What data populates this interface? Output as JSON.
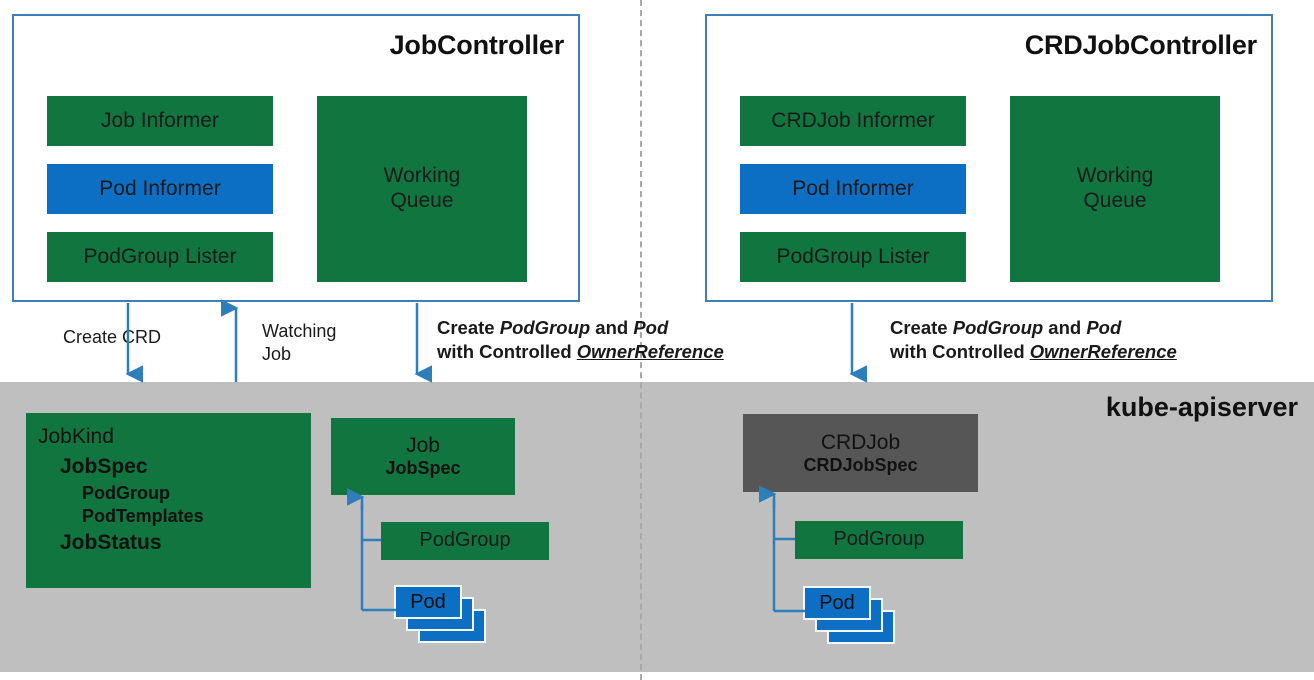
{
  "diagram": {
    "apiserver_label": "kube-apiserver",
    "colors": {
      "green": "#10753f",
      "blue": "#0d6fc4",
      "gray_band": "#bfbfbf",
      "dark_gray_block": "#565656",
      "panel_border": "#3f7eb6",
      "arrow": "#2e7ebb"
    }
  },
  "left": {
    "panel_title": "JobController",
    "blocks": [
      {
        "label": "Job Informer",
        "color": "green"
      },
      {
        "label": "Pod Informer",
        "color": "blue"
      },
      {
        "label": "PodGroup Lister",
        "color": "green"
      },
      {
        "label": "Working\nQueue",
        "color": "green"
      }
    ],
    "arrows": [
      {
        "label": "Create CRD",
        "direction": "down"
      },
      {
        "label": "Watching\nJob",
        "direction": "up"
      },
      {
        "label_line1_prefix": "Create ",
        "label_line1_em1": "PodGroup",
        "label_line1_mid": " and ",
        "label_line1_em2": "Pod",
        "label_line2_prefix": "with Controlled ",
        "label_line2_em": "OwnerReference",
        "direction": "down"
      }
    ],
    "kind_box": {
      "head": "JobKind",
      "line1": "JobSpec",
      "line2": "PodGroup",
      "line3": "PodTemplates",
      "line4": "JobStatus"
    },
    "job_box": {
      "title": "Job",
      "subtitle": "JobSpec"
    },
    "podgroup_box": {
      "label": "PodGroup"
    },
    "pod_box": {
      "label": "Pod"
    }
  },
  "right": {
    "panel_title": "CRDJobController",
    "blocks": [
      {
        "label": "CRDJob Informer",
        "color": "green"
      },
      {
        "label": "Pod Informer",
        "color": "blue"
      },
      {
        "label": "PodGroup Lister",
        "color": "green"
      },
      {
        "label": "Working\nQueue",
        "color": "green"
      }
    ],
    "arrows": [
      {
        "label_line1_prefix": "Create ",
        "label_line1_em1": "PodGroup",
        "label_line1_mid": " and ",
        "label_line1_em2": "Pod",
        "label_line2_prefix": "with Controlled ",
        "label_line2_em": "OwnerReference",
        "direction": "down"
      }
    ],
    "job_box": {
      "title": "CRDJob",
      "subtitle": "CRDJobSpec"
    },
    "podgroup_box": {
      "label": "PodGroup"
    },
    "pod_box": {
      "label": "Pod"
    }
  }
}
